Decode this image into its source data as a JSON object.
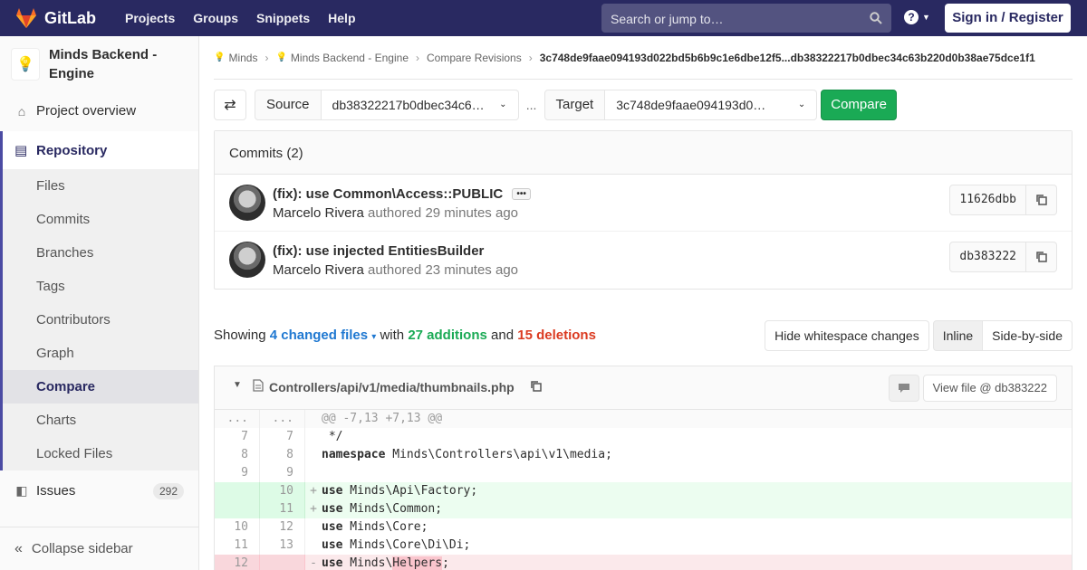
{
  "navbar": {
    "brand": "GitLab",
    "links": [
      "Projects",
      "Groups",
      "Snippets",
      "Help"
    ],
    "search_placeholder": "Search or jump to…",
    "sign_in": "Sign in / Register"
  },
  "sidebar": {
    "project_name": "Minds Backend - Engine",
    "overview": "Project overview",
    "repository": "Repository",
    "repo_items": [
      "Files",
      "Commits",
      "Branches",
      "Tags",
      "Contributors",
      "Graph",
      "Compare",
      "Charts",
      "Locked Files"
    ],
    "active_item": "Compare",
    "issues": "Issues",
    "issues_count": "292",
    "collapse": "Collapse sidebar"
  },
  "breadcrumb": {
    "items": [
      "Minds",
      "Minds Backend - Engine",
      "Compare Revisions"
    ],
    "current": "3c748de9faae094193d022bd5b6b9c1e6dbe12f5...db38322217b0dbec34c63b220d0b38ae75dce1f1"
  },
  "compare": {
    "source_label": "Source",
    "source_value": "db38322217b0dbec34c6…",
    "dots": "...",
    "target_label": "Target",
    "target_value": "3c748de9faae094193d0…",
    "button": "Compare"
  },
  "commits": {
    "header": "Commits (2)",
    "list": [
      {
        "title": "(fix): use Common\\Access::PUBLIC",
        "author": "Marcelo Rivera",
        "verb": "authored",
        "time": "29 minutes ago",
        "sha": "11626dbb"
      },
      {
        "title": "(fix): use injected EntitiesBuilder",
        "author": "Marcelo Rivera",
        "verb": "authored",
        "time": "23 minutes ago",
        "sha": "db383222"
      }
    ]
  },
  "stats": {
    "showing": "Showing",
    "changed": "4 changed files",
    "with": "with",
    "additions": "27 additions",
    "and": "and",
    "deletions": "15 deletions"
  },
  "diff_view": {
    "whitespace": "Hide whitespace changes",
    "inline": "Inline",
    "side": "Side-by-side"
  },
  "file": {
    "path": "Controllers/api/v1/media/thumbnails.php",
    "view_file": "View file @ db383222",
    "lines": [
      {
        "type": "match",
        "old": "...",
        "new": "...",
        "sign": "",
        "kw": "",
        "text": "@@ -7,13 +7,13 @@"
      },
      {
        "type": "ctx",
        "old": "7",
        "new": "7",
        "sign": "",
        "kw": "",
        "text": " */"
      },
      {
        "type": "ctx",
        "old": "8",
        "new": "8",
        "sign": "",
        "kw": "namespace",
        "text": " Minds\\Controllers\\api\\v1\\media;"
      },
      {
        "type": "ctx",
        "old": "9",
        "new": "9",
        "sign": "",
        "kw": "",
        "text": ""
      },
      {
        "type": "add",
        "old": "",
        "new": "10",
        "sign": "+",
        "kw": "use",
        "text": " Minds\\Api\\Factory;"
      },
      {
        "type": "add",
        "old": "",
        "new": "11",
        "sign": "+",
        "kw": "use",
        "text": " Minds\\Common;"
      },
      {
        "type": "ctx",
        "old": "10",
        "new": "12",
        "sign": "",
        "kw": "use",
        "text": " Minds\\Core;"
      },
      {
        "type": "ctx",
        "old": "11",
        "new": "13",
        "sign": "",
        "kw": "use",
        "text": " Minds\\Core\\Di\\Di;"
      },
      {
        "type": "del",
        "old": "12",
        "new": "",
        "sign": "-",
        "kw": "use",
        "text": " Minds\\",
        "hl": "Helpers",
        "tail": ";"
      }
    ]
  },
  "colors": {
    "navbar": "#292961",
    "compare_button": "#1aaa55",
    "additions": "#1aaa55",
    "deletions": "#db3b21",
    "link": "#1f78d1"
  }
}
